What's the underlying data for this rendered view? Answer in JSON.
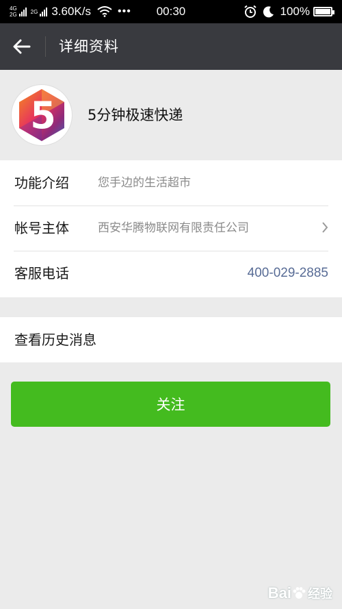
{
  "status_bar": {
    "net_top": "4G",
    "net_bottom": "2G",
    "net2_top": "2G",
    "speed": "3.60K/s",
    "dots": "•••",
    "time": "00:30",
    "battery": "100%",
    "battery_level": 1.0
  },
  "header": {
    "title": "详细资料",
    "back_icon": "arrow-left-icon"
  },
  "profile": {
    "name": "5分钟极速快递",
    "avatar_glyph": "5"
  },
  "info": {
    "intro_label": "功能介绍",
    "intro_value": "您手边的生活超市",
    "account_label": "帐号主体",
    "account_value": "西安华腾物联网有限责任公司",
    "phone_label": "客服电话",
    "phone_value": "400-029-2885"
  },
  "history": {
    "label": "查看历史消息"
  },
  "actions": {
    "follow_label": "关注"
  },
  "watermark": {
    "text": "Bai",
    "suffix": "经验"
  },
  "colors": {
    "titlebar": "#393a3f",
    "accent_green": "#44bb1f",
    "link_blue": "#576b95",
    "background": "#ebebeb"
  }
}
